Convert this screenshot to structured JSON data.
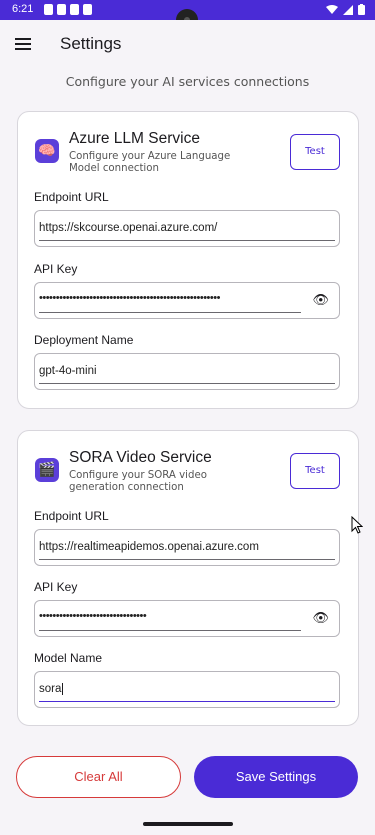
{
  "status_bar": {
    "time": "6:21",
    "bg_color": "#4a2bd6"
  },
  "app_bar": {
    "title": "Settings",
    "menu_icon": "hamburger-menu-icon"
  },
  "header": {
    "subtitle": "Configure your AI services connections"
  },
  "services": [
    {
      "icon": "brain-icon",
      "icon_glyph": "🧠",
      "name": "Azure LLM Service",
      "description": "Configure your Azure Language Model connection",
      "test_label": "Test",
      "fields": [
        {
          "label": "Endpoint URL",
          "value": "https://skcourse.openai.azure.com/"
        },
        {
          "label": "API Key",
          "value": "••••••••••••••••••••••••••••••••••••••••••••••••••••••"
        },
        {
          "label": "Deployment Name",
          "value": "gpt-4o-mini"
        }
      ]
    },
    {
      "icon": "clapperboard-icon",
      "icon_glyph": "🎬",
      "name": "SORA Video Service",
      "description": "Configure your SORA video generation connection",
      "test_label": "Test",
      "fields": [
        {
          "label": "Endpoint URL",
          "value": "https://realtimeapidemos.openai.azure.com"
        },
        {
          "label": "API Key",
          "value": "••••••••••••••••••••••••••••••••"
        },
        {
          "label": "Model Name",
          "value": "sora"
        }
      ]
    }
  ],
  "actions": {
    "clear_label": "Clear All",
    "save_label": "Save Settings"
  },
  "colors": {
    "accent": "#4a2bd6",
    "danger": "#d63a3a"
  }
}
